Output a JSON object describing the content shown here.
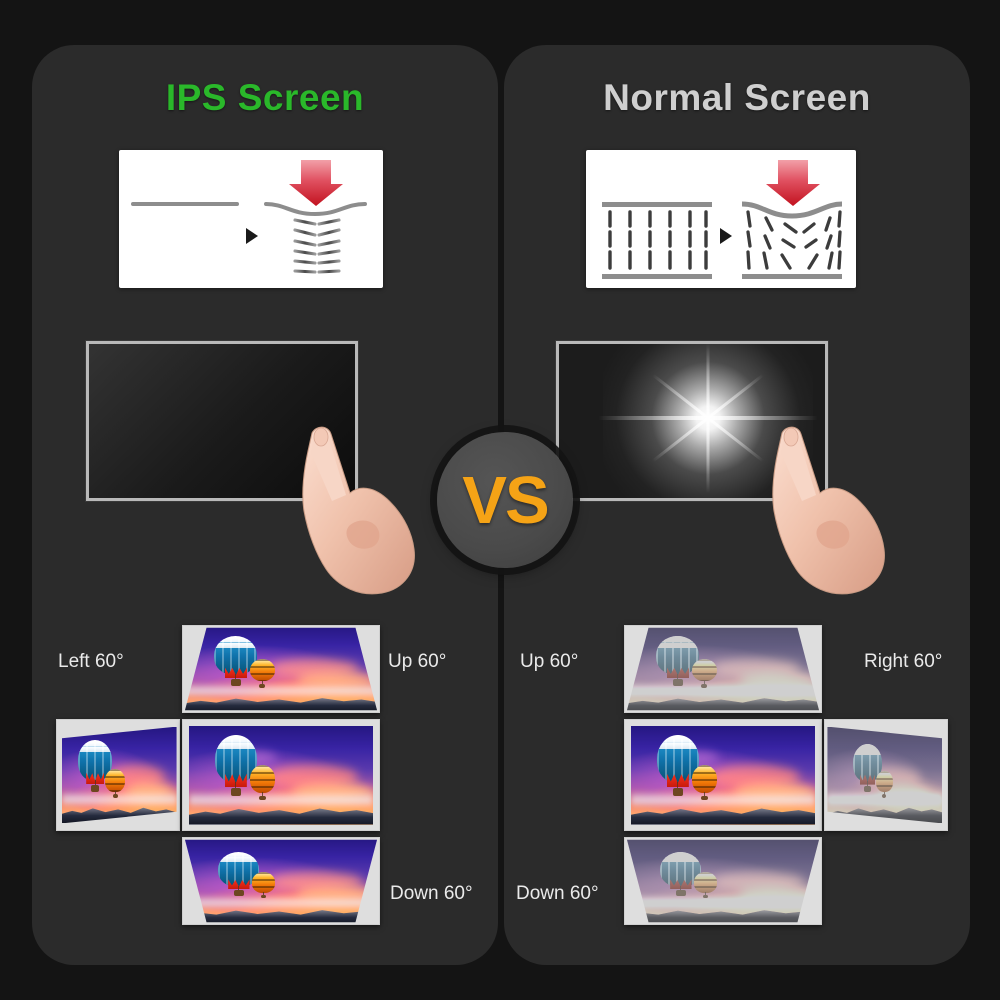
{
  "page": {
    "background_color": "#141414",
    "panel_color": "#2b2b2b",
    "vs_badge_text": "VS",
    "vs_badge_color": "#f5a316"
  },
  "panels": [
    {
      "id": "ips",
      "title": "IPS Screen",
      "title_color": "#2ab82a",
      "crystal_diagram": {
        "before_state": "horizontal-aligned-crystals",
        "after_state": "horizontal-crystals-under-pressure",
        "pressure_arrow_color": "#d42a3a",
        "transition_glyph": "▶"
      },
      "pressure_test": {
        "screen_state": "uniform-black-no-ripple",
        "frame_color": "#b9b9b9"
      },
      "viewing_angles": {
        "left_label": "Left 60°",
        "up_label": "Up 60°",
        "down_label": "Down 60°",
        "quality": "vivid-colors-retained"
      }
    },
    {
      "id": "normal",
      "title": "Normal Screen",
      "title_color": "#cfcfcf",
      "crystal_diagram": {
        "before_state": "vertical-aligned-crystals",
        "after_state": "vertical-crystals-distorted-under-pressure",
        "pressure_arrow_color": "#d42a3a",
        "transition_glyph": "▶"
      },
      "pressure_test": {
        "screen_state": "white-starburst-glow-at-touch-point",
        "frame_color": "#b9b9b9"
      },
      "viewing_angles": {
        "up_label": "Up 60°",
        "right_label": "Right 60°",
        "down_label": "Down 60°",
        "quality": "colors-washed-out"
      }
    }
  ]
}
